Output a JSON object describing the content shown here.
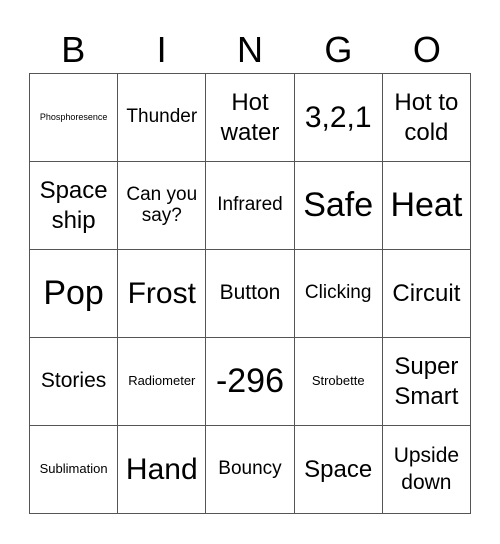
{
  "header": [
    "B",
    "I",
    "N",
    "G",
    "O"
  ],
  "cells": [
    {
      "text": "Phosphoresence",
      "size": "s9"
    },
    {
      "text": "Thunder",
      "size": "s19"
    },
    {
      "text": "Hot water",
      "size": "s24"
    },
    {
      "text": "3,2,1",
      "size": "s30"
    },
    {
      "text": "Hot to cold",
      "size": "s24"
    },
    {
      "text": "Space ship",
      "size": "s24"
    },
    {
      "text": "Can you say?",
      "size": "s19"
    },
    {
      "text": "Infrared",
      "size": "s19"
    },
    {
      "text": "Safe",
      "size": "s34"
    },
    {
      "text": "Heat",
      "size": "s34"
    },
    {
      "text": "Pop",
      "size": "s34"
    },
    {
      "text": "Frost",
      "size": "s30"
    },
    {
      "text": "Button",
      "size": "s21"
    },
    {
      "text": "Clicking",
      "size": "s19"
    },
    {
      "text": "Circuit",
      "size": "s24"
    },
    {
      "text": "Stories",
      "size": "s21"
    },
    {
      "text": "Radiometer",
      "size": "s13"
    },
    {
      "text": "-296",
      "size": "s34"
    },
    {
      "text": "Strobette",
      "size": "s13"
    },
    {
      "text": "Super Smart",
      "size": "s24"
    },
    {
      "text": "Sublimation",
      "size": "s13"
    },
    {
      "text": "Hand",
      "size": "s30"
    },
    {
      "text": "Bouncy",
      "size": "s19"
    },
    {
      "text": "Space",
      "size": "s24"
    },
    {
      "text": "Upside down",
      "size": "s21"
    }
  ]
}
